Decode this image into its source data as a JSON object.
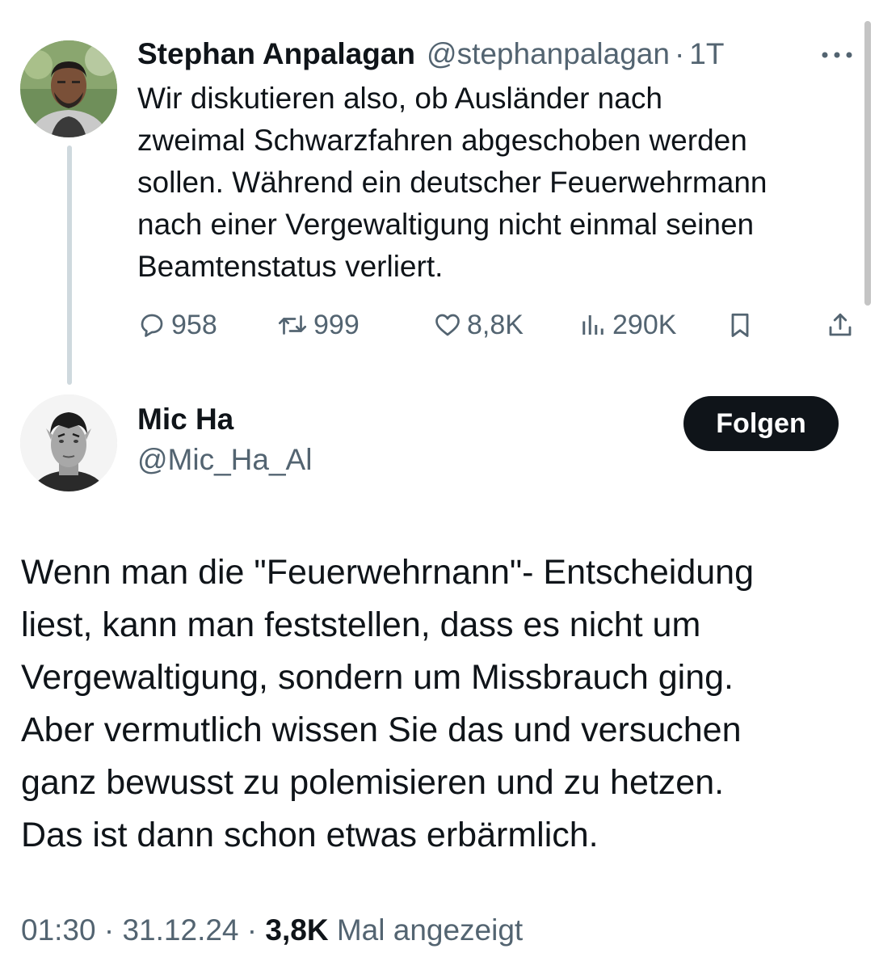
{
  "thread": {
    "original": {
      "author_name": "Stephan Anpalagan",
      "handle": "@stephanpalagan",
      "separator": "·",
      "time": "1T",
      "text": "Wir diskutieren also, ob Ausländer nach\nzweimal Schwarzfahren abgeschoben werden\nsollen. Während ein deutscher Feuerwehrmann\nnach einer Vergewaltigung nicht einmal seinen\nBeamtenstatus verliert.",
      "actions": {
        "replies": "958",
        "reposts": "999",
        "likes": "8,8K",
        "views": "290K"
      }
    },
    "reply": {
      "author_name": "Mic Ha",
      "handle": "@Mic_Ha_Al",
      "follow_label": "Folgen",
      "text": "Wenn man die \"Feuerwehrnann\"- Entscheidung\nliest, kann man feststellen, dass es nicht um\nVergewaltigung, sondern um Missbrauch ging.\nAber vermutlich wissen Sie das und versuchen\nganz bewusst zu polemisieren und zu hetzen.\nDas ist dann schon etwas erbärmlich.",
      "meta": {
        "time": "01:30",
        "sep1": "·",
        "date": "31.12.24",
        "sep2": "·",
        "view_count": "3,8K",
        "view_label": "Mal angezeigt"
      }
    }
  },
  "icons": {
    "more": "more-horizontal-icon",
    "reply": "reply-bubble-icon",
    "repost": "repost-icon",
    "like": "heart-icon",
    "views": "views-chart-icon",
    "bookmark": "bookmark-icon",
    "share": "share-upload-icon"
  },
  "colors": {
    "text_primary": "#0f1419",
    "text_secondary": "#536471",
    "thread_line": "#cfd9de",
    "follow_button_bg": "#0f1419",
    "follow_button_text": "#ffffff"
  }
}
